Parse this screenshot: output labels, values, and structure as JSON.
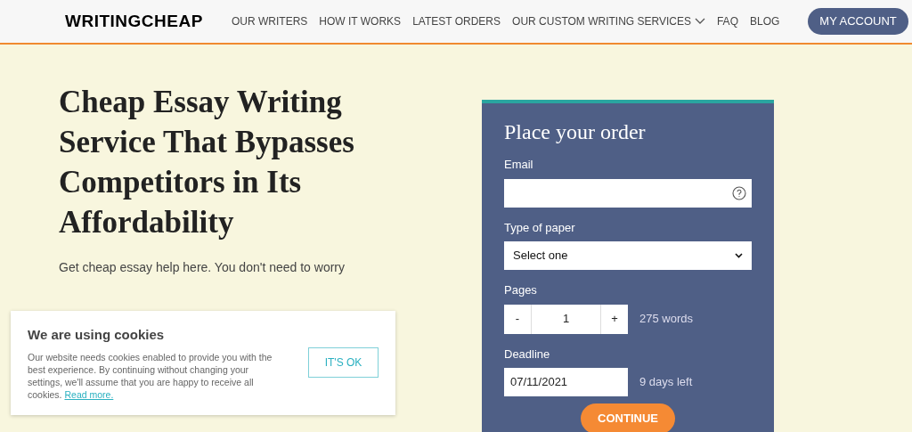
{
  "header": {
    "logo": "WRITINGCHEAP",
    "nav": [
      {
        "label": "OUR WRITERS",
        "dropdown": false
      },
      {
        "label": "HOW IT WORKS",
        "dropdown": false
      },
      {
        "label": "LATEST ORDERS",
        "dropdown": false
      },
      {
        "label": "OUR CUSTOM WRITING SERVICES",
        "dropdown": true
      },
      {
        "label": "FAQ",
        "dropdown": false
      },
      {
        "label": "BLOG",
        "dropdown": false
      }
    ],
    "account_button": "MY ACCOUNT"
  },
  "hero": {
    "title": "Cheap Essay Writing Service That Bypasses Competitors in Its Affordability",
    "intro": "Get cheap essay help here. You don't need to worry"
  },
  "order_form": {
    "title": "Place your order",
    "email": {
      "label": "Email"
    },
    "paper_type": {
      "label": "Type of paper",
      "value": "Select one"
    },
    "pages": {
      "label": "Pages",
      "minus": "-",
      "value": "1",
      "plus": "+",
      "words": "275 words"
    },
    "deadline": {
      "label": "Deadline",
      "value": "07/11/2021",
      "days_left": "9 days left"
    },
    "continue_button": "CONTINUE"
  },
  "cookie_banner": {
    "title": "We are using cookies",
    "text": "Our website needs cookies enabled to provide you with the best experience. By continuing without changing your settings, we'll assume that you are happy to receive all cookies.",
    "link": "Read more.",
    "button": "IT'S OK"
  }
}
